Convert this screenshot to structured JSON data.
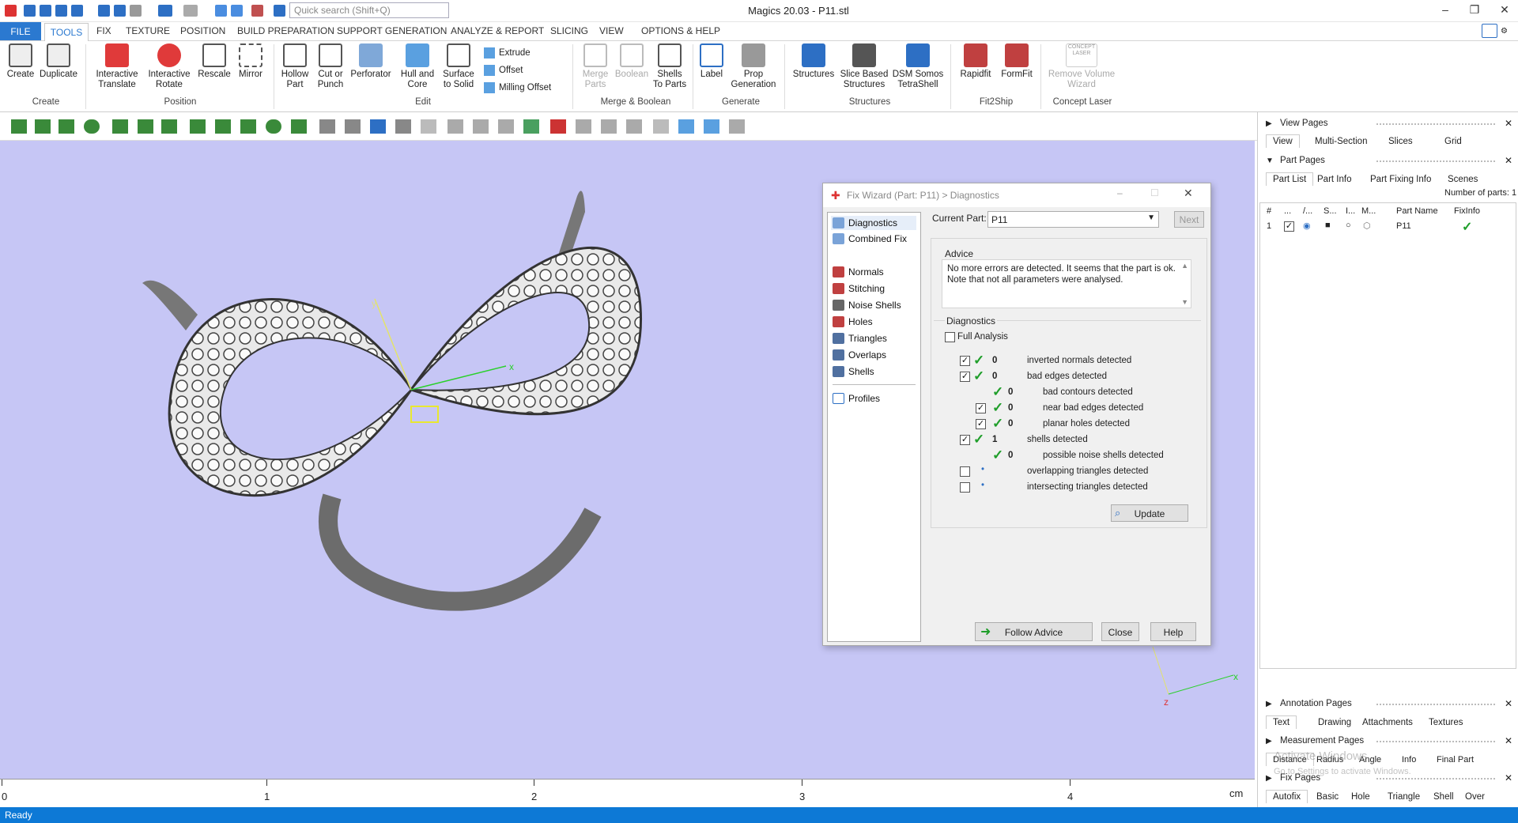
{
  "title_bar": {
    "search_placeholder": "Quick search (Shift+Q)",
    "window_title": "Magics 20.03 - P11.stl",
    "minimize": "–",
    "restore": "❐",
    "close": "✕"
  },
  "menu": {
    "tabs": [
      "FILE",
      "TOOLS",
      "FIX",
      "TEXTURE",
      "POSITION",
      "BUILD PREPARATION",
      "SUPPORT GENERATION",
      "ANALYZE & REPORT",
      "SLICING",
      "VIEW",
      "OPTIONS & HELP"
    ]
  },
  "ribbon": {
    "buttons": [
      "Create",
      "Duplicate",
      "Interactive Translate",
      "Interactive Rotate",
      "Rescale",
      "Mirror",
      "Hollow Part",
      "Cut or Punch",
      "Perforator",
      "Hull and Core",
      "Surface to Solid",
      "Extrude",
      "Offset",
      "Milling Offset",
      "Merge Parts",
      "Boolean",
      "Shells To Parts",
      "Label",
      "Prop Generation",
      "Structures",
      "Slice Based Structures",
      "DSM Somos TetraShell",
      "Rapidfit",
      "FormFit",
      "Remove Volume Wizard"
    ],
    "groups": [
      "Create",
      "Position",
      "Edit",
      "Merge & Boolean",
      "Generate",
      "Structures",
      "Fit2Ship",
      "Concept Laser"
    ],
    "concept_laser_logo": "CONCEPT LASER"
  },
  "viewport": {
    "axes": {
      "x": "x",
      "y": "y",
      "z": "z"
    }
  },
  "ruler": {
    "labels": [
      "0",
      "1",
      "2",
      "3",
      "4"
    ],
    "unit": "cm"
  },
  "status": {
    "text": "Ready"
  },
  "right_panel": {
    "view_pages": {
      "title": "View Pages",
      "tabs": [
        "View",
        "Multi-Section",
        "Slices",
        "Grid"
      ]
    },
    "part_pages": {
      "title": "Part Pages",
      "tabs": [
        "Part List",
        "Part Info",
        "Part Fixing Info",
        "Scenes"
      ],
      "number_of_parts": "Number of parts: 1",
      "columns": [
        "#",
        "...",
        "/...",
        "S...",
        "I...",
        "M...",
        "Part Name",
        "FixInfo"
      ],
      "rows": [
        {
          "num": "1",
          "name": "P11"
        }
      ]
    },
    "annotation_pages": {
      "title": "Annotation Pages",
      "tabs": [
        "Text",
        "Drawing",
        "Attachments",
        "Textures"
      ]
    },
    "measurement_pages": {
      "title": "Measurement Pages",
      "tabs": [
        "Distance",
        "Radius",
        "Angle",
        "Info",
        "Final Part"
      ]
    },
    "fix_pages": {
      "title": "Fix Pages",
      "tabs": [
        "Autofix",
        "Basic",
        "Hole",
        "Triangle",
        "Shell",
        "Over"
      ]
    },
    "watermark": [
      "Activate Windows",
      "Go to Settings to activate Windows."
    ]
  },
  "dialog": {
    "title": "Fix Wizard (Part: P11) > Diagnostics",
    "nav": [
      "Diagnostics",
      "Combined Fix",
      "Normals",
      "Stitching",
      "Noise Shells",
      "Holes",
      "Triangles",
      "Overlaps",
      "Shells",
      "Profiles"
    ],
    "current_part_label": "Current Part:",
    "current_part": "P11",
    "next": "Next",
    "advice_label": "Advice",
    "advice_text": "No more errors are detected. It seems that the part is ok. Note that not all parameters were analysed.",
    "diagnostics_label": "Diagnostics",
    "full_analysis": "Full Analysis",
    "rows": [
      {
        "count": "0",
        "label": "inverted normals detected"
      },
      {
        "count": "0",
        "label": "bad edges detected"
      },
      {
        "count": "0",
        "label": "bad contours detected"
      },
      {
        "count": "0",
        "label": "near bad edges detected"
      },
      {
        "count": "0",
        "label": "planar holes detected"
      },
      {
        "count": "1",
        "label": "shells detected"
      },
      {
        "count": "0",
        "label": "possible noise shells detected"
      },
      {
        "count": "",
        "label": "overlapping triangles detected"
      },
      {
        "count": "",
        "label": "intersecting triangles detected"
      }
    ],
    "update": "Update",
    "follow_advice": "Follow Advice",
    "close": "Close",
    "help": "Help"
  }
}
